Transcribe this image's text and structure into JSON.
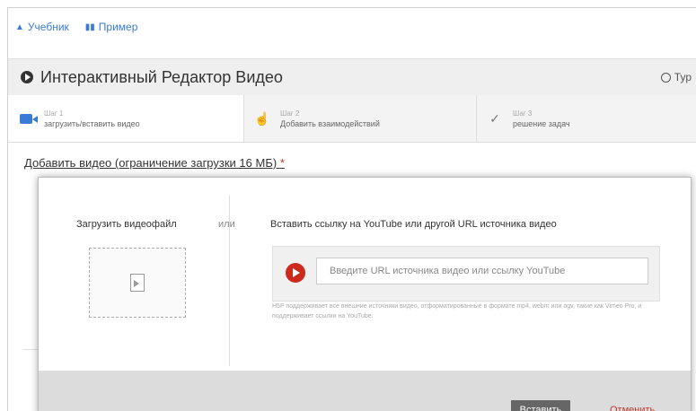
{
  "breadcrumbs": [
    {
      "label": "Учебник",
      "icon": "tree-icon"
    },
    {
      "label": "Пример",
      "icon": "chart-icon"
    }
  ],
  "header": {
    "title": "Интерактивный Редактор Видео",
    "tour_label": "Тур"
  },
  "steps": [
    {
      "number": "Шаг 1",
      "label": "загрузить/вставить видео",
      "icon": "video-camera-icon",
      "active": true
    },
    {
      "number": "Шаг 2",
      "label": "Добавить взаимодействий",
      "icon": "pointer-icon",
      "active": false
    },
    {
      "number": "Шаг 3",
      "label": "решение задач",
      "icon": "check-circle-icon",
      "active": false
    }
  ],
  "section_title": "Добавить видео (ограничение загрузки 16 МБ)",
  "required_mark": "*",
  "modal": {
    "upload_label": "Загрузить видеофайл",
    "or_label": "или",
    "paste_label": "Вставить ссылку на YouTube или другой URL источника видео",
    "url_placeholder": "Введите URL источника видео или ссылку YouTube",
    "url_value": "",
    "hint": "H5P поддерживает все внешние источники видео, отформатированные в формате mp4, webm или ogv, такие как Vimeo Pro, и поддерживает ссылки на YouTube.",
    "insert_label": "Вставить",
    "cancel_label": "Отменить"
  },
  "colors": {
    "accent": "#3a7bd5",
    "youtube": "#cc2a1d",
    "cancel": "#c0392b",
    "insert_button": "#666666"
  }
}
